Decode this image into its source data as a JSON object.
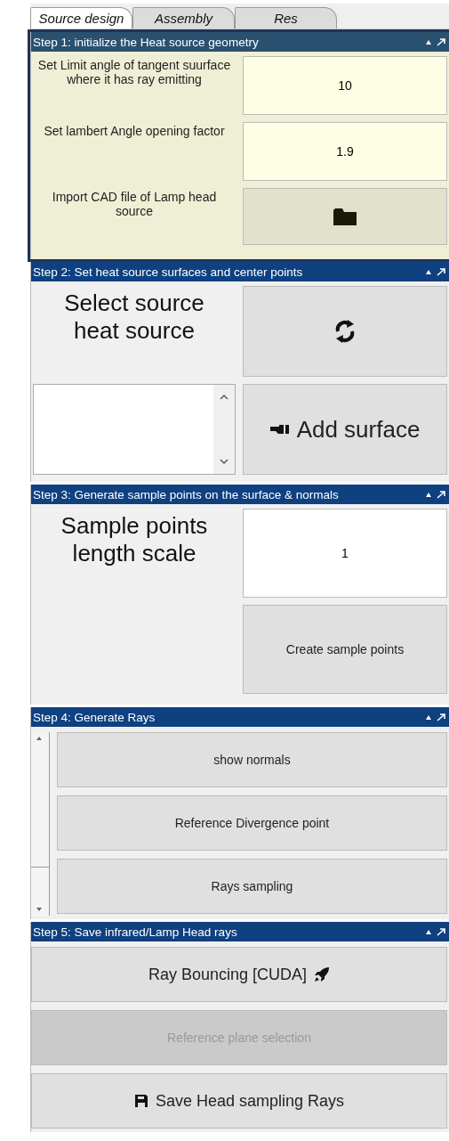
{
  "tabs": [
    {
      "label": "Source design",
      "selected": true
    },
    {
      "label": "Assembly",
      "selected": false
    },
    {
      "label": "Res",
      "selected": false
    }
  ],
  "steps": [
    {
      "kind": "form",
      "selected": true,
      "title": "Step 1: initialize the Heat source geometry",
      "rows": [
        {
          "label": "Set Limit angle of tangent suurface where it has ray emitting",
          "kind": "field",
          "value": "10"
        },
        {
          "label": "Set lambert Angle opening factor",
          "kind": "field",
          "value": "1.9"
        },
        {
          "label": "Import CAD file of Lamp head source",
          "kind": "folder"
        }
      ]
    },
    {
      "kind": "surfaces",
      "selected": false,
      "title": "Step 2: Set heat source surfaces and center points",
      "heading": "Select source heat source",
      "add_button": "Add surface"
    },
    {
      "kind": "sample",
      "selected": false,
      "title": "Step 3: Generate sample points on the surface & normals",
      "heading": "Sample points length scale",
      "value": "1",
      "button": "Create sample points"
    },
    {
      "kind": "buttons",
      "selected": false,
      "scrollbar": true,
      "title": "Step 4: Generate Rays",
      "buttons": [
        {
          "label": "show normals",
          "kind": "plain",
          "disabled": false
        },
        {
          "label": "Reference Divergence point",
          "kind": "plain",
          "disabled": false
        },
        {
          "label": "Rays sampling",
          "kind": "plain",
          "disabled": false
        }
      ]
    },
    {
      "kind": "buttons",
      "selected": false,
      "scrollbar": false,
      "title": "Step 5: Save infrared/Lamp Head rays",
      "buttons": [
        {
          "label": "Ray Bouncing [CUDA]",
          "kind": "rocket",
          "disabled": false
        },
        {
          "label": "Reference plane selection",
          "kind": "plain",
          "disabled": true
        },
        {
          "label": "Save Head sampling Rays",
          "kind": "save",
          "disabled": false
        }
      ]
    }
  ]
}
